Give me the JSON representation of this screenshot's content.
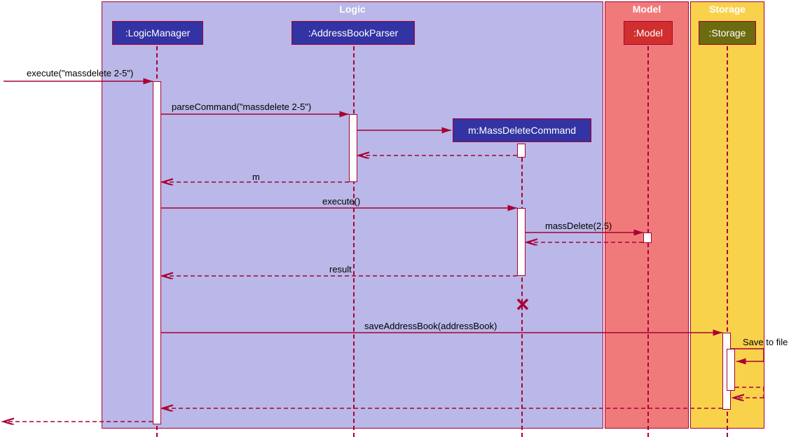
{
  "frames": {
    "logic": "Logic",
    "model": "Model",
    "storage": "Storage"
  },
  "participants": {
    "logic_manager": ":LogicManager",
    "address_book_parser": ":AddressBookParser",
    "mass_delete_command": "m:MassDeleteCommand",
    "model": ":Model",
    "storage": ":Storage"
  },
  "messages": {
    "execute_in": "execute(\"massdelete 2-5\")",
    "parse_command": "parseCommand(\"massdelete 2-5\")",
    "return_m": "m",
    "execute_empty": "execute()",
    "mass_delete": "massDelete(2,5)",
    "result": "result",
    "save_address_book": "saveAddressBook(addressBook)",
    "save_to_file": "Save to file"
  }
}
